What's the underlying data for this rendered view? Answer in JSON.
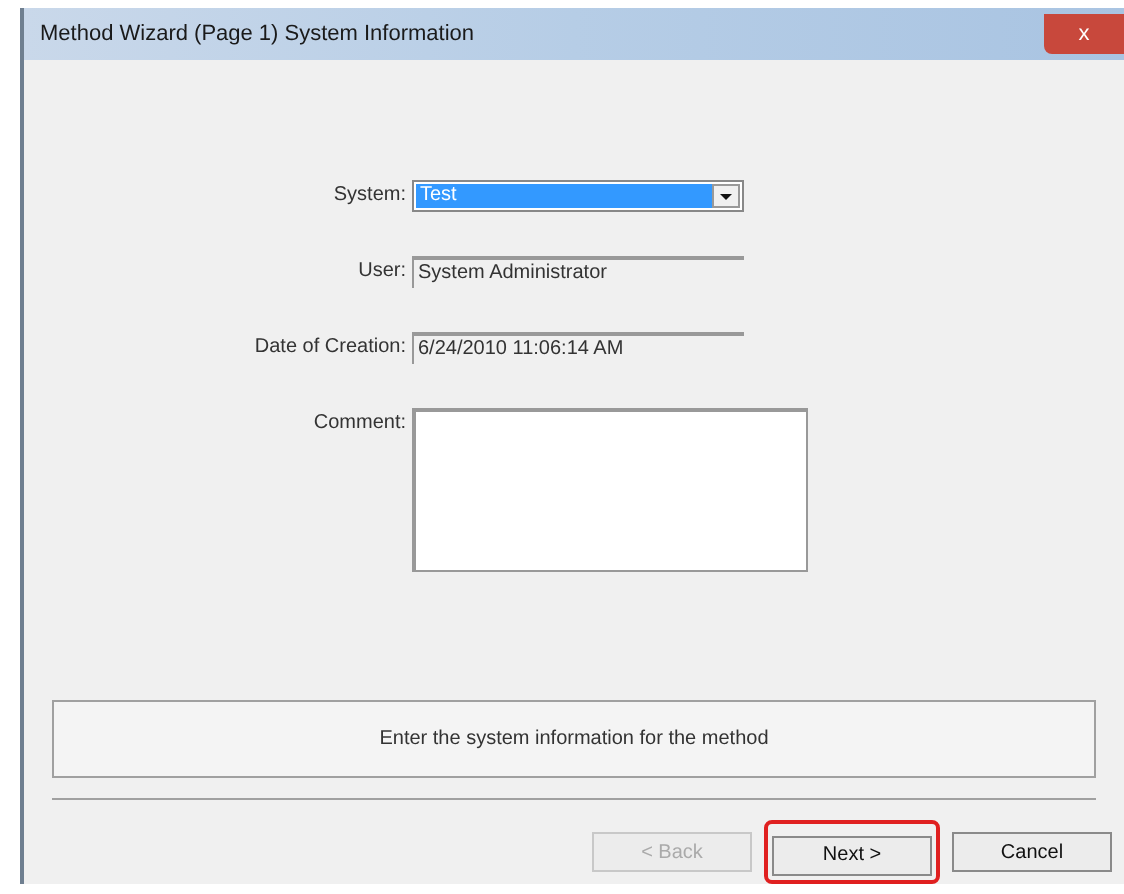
{
  "window": {
    "title": "Method Wizard (Page 1) System Information",
    "close_label": "x"
  },
  "fields": [
    {
      "kind": "combo",
      "label": "System:",
      "value": "Test"
    },
    {
      "kind": "readonly",
      "label": "User:",
      "value": "System Administrator"
    },
    {
      "kind": "readonly",
      "label": "Date of Creation:",
      "value": "6/24/2010 11:06:14 AM"
    },
    {
      "kind": "memo",
      "label": "Comment:"
    }
  ],
  "hint": "Enter the system information for the method",
  "buttons": [
    {
      "label": "< Back",
      "disabled": true,
      "highlighted": false
    },
    {
      "label": "Next >",
      "disabled": false,
      "highlighted": true
    },
    {
      "label": "Cancel",
      "disabled": false,
      "highlighted": false
    }
  ]
}
